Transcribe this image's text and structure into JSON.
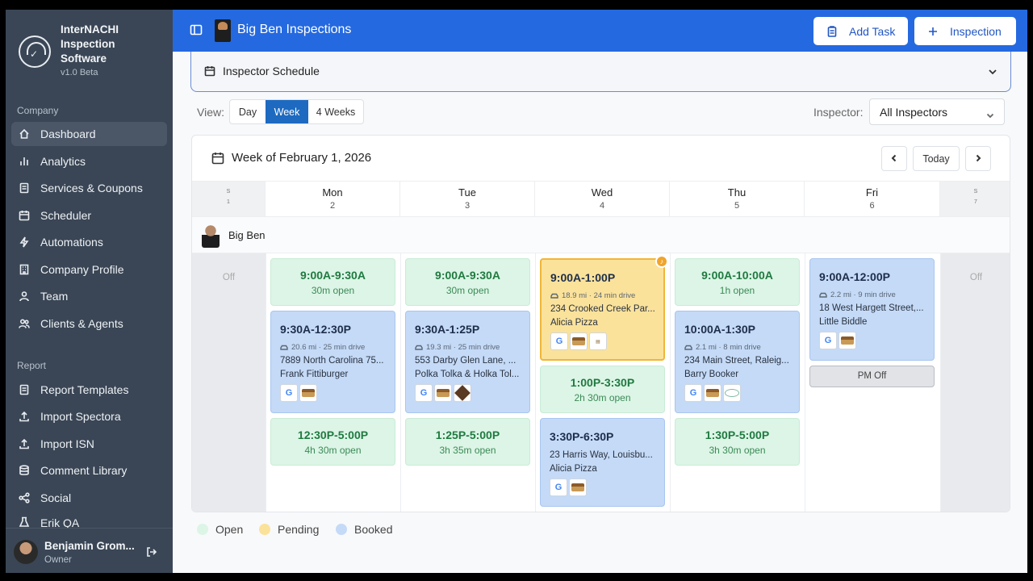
{
  "sidebar": {
    "brand_name": "InterNACHI Inspection Software",
    "brand_version": "v1.0 Beta",
    "sections": {
      "company": "Company",
      "report": "Report"
    },
    "company_items": [
      {
        "label": "Dashboard",
        "icon": "home-icon",
        "active": true
      },
      {
        "label": "Analytics",
        "icon": "bar-chart-icon"
      },
      {
        "label": "Services & Coupons",
        "icon": "document-icon"
      },
      {
        "label": "Scheduler",
        "icon": "calendar-icon"
      },
      {
        "label": "Automations",
        "icon": "lightning-icon"
      },
      {
        "label": "Company Profile",
        "icon": "building-icon"
      },
      {
        "label": "Team",
        "icon": "person-icon"
      },
      {
        "label": "Clients & Agents",
        "icon": "people-icon"
      }
    ],
    "report_items": [
      {
        "label": "Report Templates",
        "icon": "document-icon"
      },
      {
        "label": "Import Spectora",
        "icon": "upload-icon"
      },
      {
        "label": "Import ISN",
        "icon": "upload-icon"
      },
      {
        "label": "Comment Library",
        "icon": "database-icon"
      },
      {
        "label": "Social",
        "icon": "share-icon"
      },
      {
        "label": "Erik QA",
        "icon": "flask-icon"
      }
    ],
    "user": {
      "name": "Benjamin Grom...",
      "role": "Owner"
    }
  },
  "topbar": {
    "company_name": "Big Ben Inspections",
    "add_task_label": "Add Task",
    "inspection_label": "Inspection"
  },
  "schedule": {
    "title": "Inspector Schedule",
    "view_label": "View:",
    "views": [
      "Day",
      "Week",
      "4 Weeks"
    ],
    "active_view": "Week",
    "inspector_label": "Inspector:",
    "inspector_value": "All Inspectors",
    "week_title": "Week of February 1, 2026",
    "today_label": "Today"
  },
  "days": [
    {
      "name": "S",
      "num": "1",
      "off": true
    },
    {
      "name": "Mon",
      "num": "2"
    },
    {
      "name": "Tue",
      "num": "3"
    },
    {
      "name": "Wed",
      "num": "4"
    },
    {
      "name": "Thu",
      "num": "5"
    },
    {
      "name": "Fri",
      "num": "6"
    },
    {
      "name": "S",
      "num": "7",
      "off": true
    }
  ],
  "inspector": {
    "name": "Big Ben"
  },
  "off_label": "Off",
  "slots": {
    "mon": [
      {
        "type": "open",
        "time": "9:00A-9:30A",
        "sub": "30m open"
      },
      {
        "type": "booked",
        "time": "9:30A-12:30P",
        "drive": "20.6 mi · 25 min drive",
        "address": "7889 North Carolina 75...",
        "client": "Frank Fittiburger"
      },
      {
        "type": "open",
        "time": "12:30P-5:00P",
        "sub": "4h 30m open"
      }
    ],
    "tue": [
      {
        "type": "open",
        "time": "9:00A-9:30A",
        "sub": "30m open"
      },
      {
        "type": "booked",
        "time": "9:30A-1:25P",
        "drive": "19.3 mi · 25 min drive",
        "address": "553 Darby Glen Lane, ...",
        "client": "Polka Tolka & Holka Tol..."
      },
      {
        "type": "open",
        "time": "1:25P-5:00P",
        "sub": "3h 35m open"
      }
    ],
    "wed": [
      {
        "type": "pending",
        "time": "9:00A-1:00P",
        "drive": "18.9 mi · 24 min drive",
        "address": "234 Crooked Creek Par...",
        "client": "Alicia Pizza"
      },
      {
        "type": "open",
        "time": "1:00P-3:30P",
        "sub": "2h 30m open"
      },
      {
        "type": "booked",
        "time": "3:30P-6:30P",
        "address": "23 Harris Way, Louisbu...",
        "client": "Alicia Pizza"
      }
    ],
    "thu": [
      {
        "type": "open",
        "time": "9:00A-10:00A",
        "sub": "1h open"
      },
      {
        "type": "booked",
        "time": "10:00A-1:30P",
        "drive": "2.1 mi · 8 min drive",
        "address": "234 Main Street, Raleig...",
        "client": "Barry Booker"
      },
      {
        "type": "open",
        "time": "1:30P-5:00P",
        "sub": "3h 30m open"
      }
    ],
    "fri": [
      {
        "type": "booked",
        "time": "9:00A-12:00P",
        "drive": "2.2 mi · 9 min drive",
        "address": "18 West Hargett Street,...",
        "client": "Little Biddle"
      },
      {
        "type": "pmoff",
        "label": "PM Off"
      }
    ]
  },
  "legend": [
    {
      "label": "Open",
      "color": "#dcf5e6"
    },
    {
      "label": "Pending",
      "color": "#fbe29b"
    },
    {
      "label": "Booked",
      "color": "#c4daf7"
    }
  ],
  "colors": {
    "topbar": "#2469e0",
    "sidebar": "#3a4655",
    "active_view": "#1d6ac0"
  }
}
